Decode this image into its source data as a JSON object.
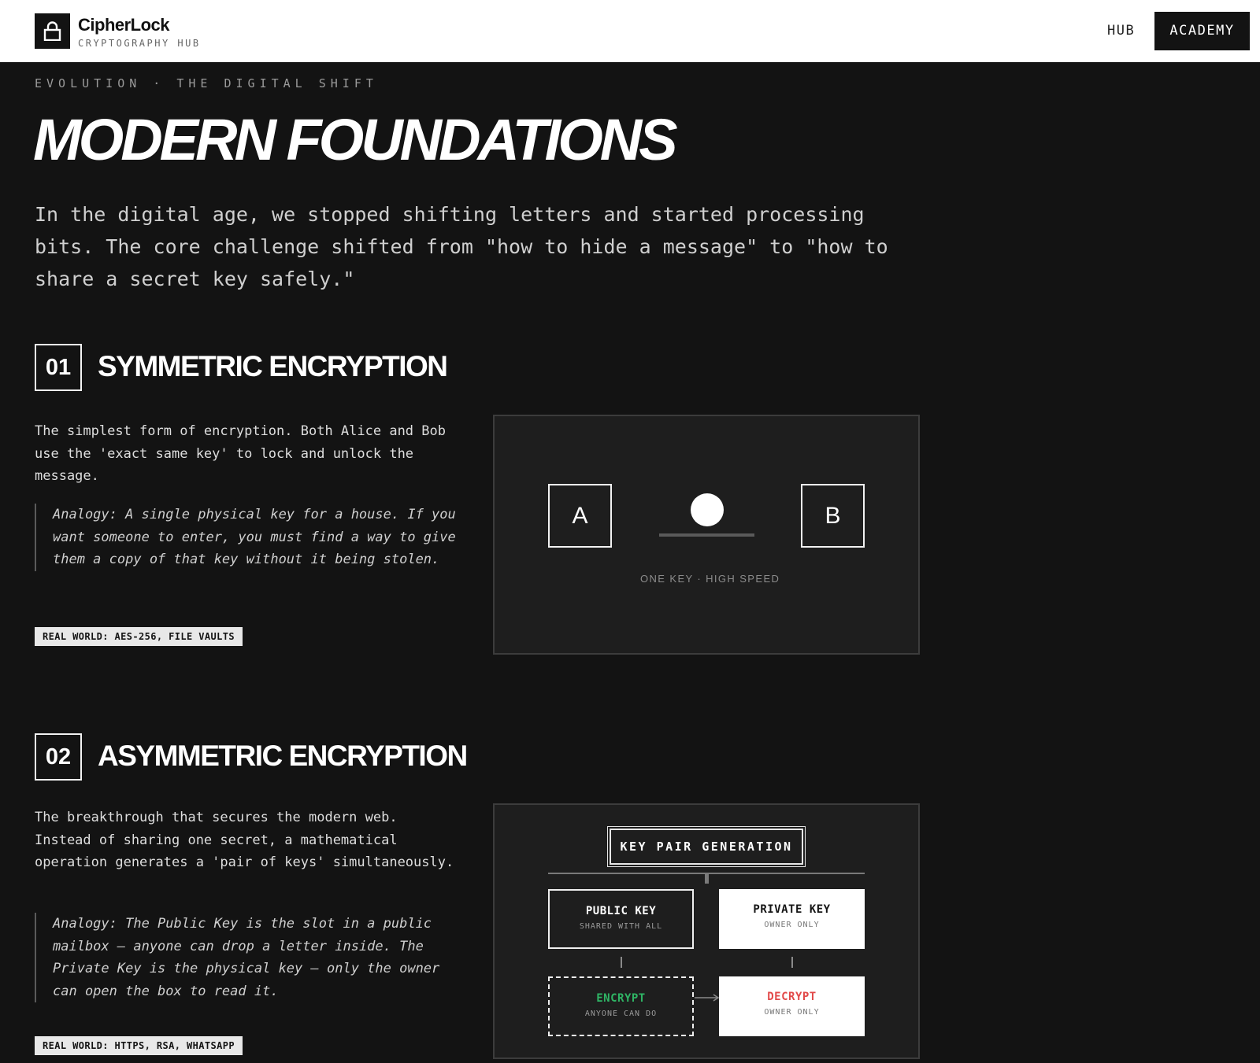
{
  "header": {
    "brand_name": "CipherLock",
    "brand_subtitle": "CRYPTOGRAPHY HUB",
    "logo_icon": "lock-icon",
    "nav": [
      {
        "label": "HUB",
        "active": false
      },
      {
        "label": "ACADEMY",
        "active": true
      }
    ]
  },
  "hero": {
    "eyebrow": "EVOLUTION · THE DIGITAL SHIFT",
    "title": "MODERN FOUNDATIONS",
    "lead": "In the digital age, we stopped shifting letters and started processing bits. The core challenge shifted from \"how to hide a message\" to \"how to share a secret key safely.\""
  },
  "sections": [
    {
      "number": "01",
      "title": "SYMMETRIC ENCRYPTION",
      "body": "The simplest form of encryption. Both Alice and Bob use the 'exact same key' to lock and unlock the message.",
      "analogy": "Analogy: A single physical key for a house. If you want someone to enter, you must find a way to give them a copy of that key without it being stolen.",
      "real_world": "REAL WORLD: AES-256, FILE VAULTS",
      "diagram": {
        "party_a": "A",
        "party_b": "B",
        "caption": "ONE KEY · HIGH SPEED"
      }
    },
    {
      "number": "02",
      "title": "ASYMMETRIC ENCRYPTION",
      "body": "The breakthrough that secures the modern web. Instead of sharing one secret, a mathematical operation generates a 'pair of keys' simultaneously.",
      "analogy": "Analogy: The Public Key is the slot in a public mailbox — anyone can drop a letter inside. The Private Key is the physical key — only the owner can open the box to read it.",
      "real_world": "REAL WORLD: HTTPS, RSA, WHATSAPP",
      "diagram": {
        "root": "KEY PAIR GENERATION",
        "public_key": {
          "title": "PUBLIC KEY",
          "sub": "SHARED WITH ALL"
        },
        "private_key": {
          "title": "PRIVATE KEY",
          "sub": "OWNER ONLY"
        },
        "encrypt": {
          "title": "ENCRYPT",
          "sub": "ANYONE CAN DO"
        },
        "decrypt": {
          "title": "DECRYPT",
          "sub": "OWNER ONLY"
        }
      }
    }
  ],
  "colors": {
    "background": "#131313",
    "panel": "#1e1e1e",
    "encrypt_green": "#2fb565",
    "decrypt_red": "#e24a4a"
  }
}
